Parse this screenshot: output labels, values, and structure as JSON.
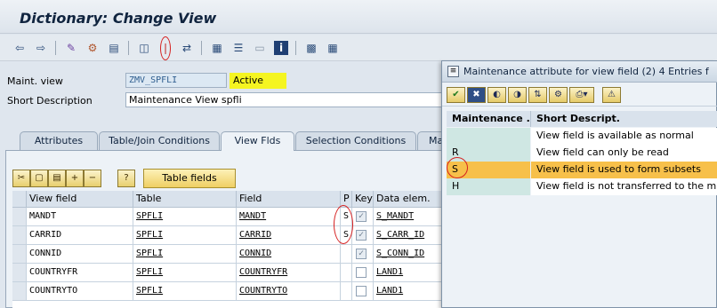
{
  "window": {
    "title": "Dictionary: Change View"
  },
  "toolbar": {
    "icons": [
      "back-icon",
      "forward-icon",
      "other-object-icon",
      "display-change-icon",
      "activate-icon",
      "where-used-icon",
      "hierarchy-icon",
      "object-list-icon",
      "navigation-window-icon",
      "documentation-icon",
      "info-icon",
      "technical-settings-icon",
      "utilities-icon"
    ]
  },
  "header": {
    "maint_view_label": "Maint. view",
    "maint_view_value": "ZMV_SPFLI",
    "status": "Active",
    "short_desc_label": "Short Description",
    "short_desc_value": "Maintenance View spfli"
  },
  "tabs": [
    {
      "label": "Attributes"
    },
    {
      "label": "Table/Join Conditions"
    },
    {
      "label": "View Flds"
    },
    {
      "label": "Selection Conditions"
    },
    {
      "label": "Ma"
    }
  ],
  "grid": {
    "table_fields_button": "Table fields",
    "columns": [
      "View field",
      "Table",
      "Field",
      "P",
      "Key",
      "Data elem."
    ],
    "rows": [
      {
        "view_field": "MANDT",
        "table": "SPFLI",
        "field": "MANDT",
        "p": "S",
        "key": true,
        "data_elem": "S_MANDT"
      },
      {
        "view_field": "CARRID",
        "table": "SPFLI",
        "field": "CARRID",
        "p": "S",
        "key": true,
        "data_elem": "S_CARR_ID"
      },
      {
        "view_field": "CONNID",
        "table": "SPFLI",
        "field": "CONNID",
        "p": "",
        "key": true,
        "data_elem": "S_CONN_ID"
      },
      {
        "view_field": "COUNTRYFR",
        "table": "SPFLI",
        "field": "COUNTRYFR",
        "p": "",
        "key": false,
        "data_elem": "LAND1"
      },
      {
        "view_field": "COUNTRYTO",
        "table": "SPFLI",
        "field": "COUNTRYTO",
        "p": "",
        "key": false,
        "data_elem": "LAND1"
      }
    ]
  },
  "popup": {
    "title": "Maintenance attribute for view field (2)    4 Entries f",
    "columns": [
      "Maintenance ...",
      "Short Descript."
    ],
    "rows": [
      {
        "code": "",
        "desc": "View field is available as normal"
      },
      {
        "code": "R",
        "desc": "View field can only be read"
      },
      {
        "code": "S",
        "desc": "View field is used to form subsets"
      },
      {
        "code": "H",
        "desc": "View field is not transferred to the m"
      }
    ],
    "selected_row": 2
  },
  "colors": {
    "status_highlight": "#f5f521",
    "selection": "#f7c04a",
    "annotation": "#d62020"
  }
}
